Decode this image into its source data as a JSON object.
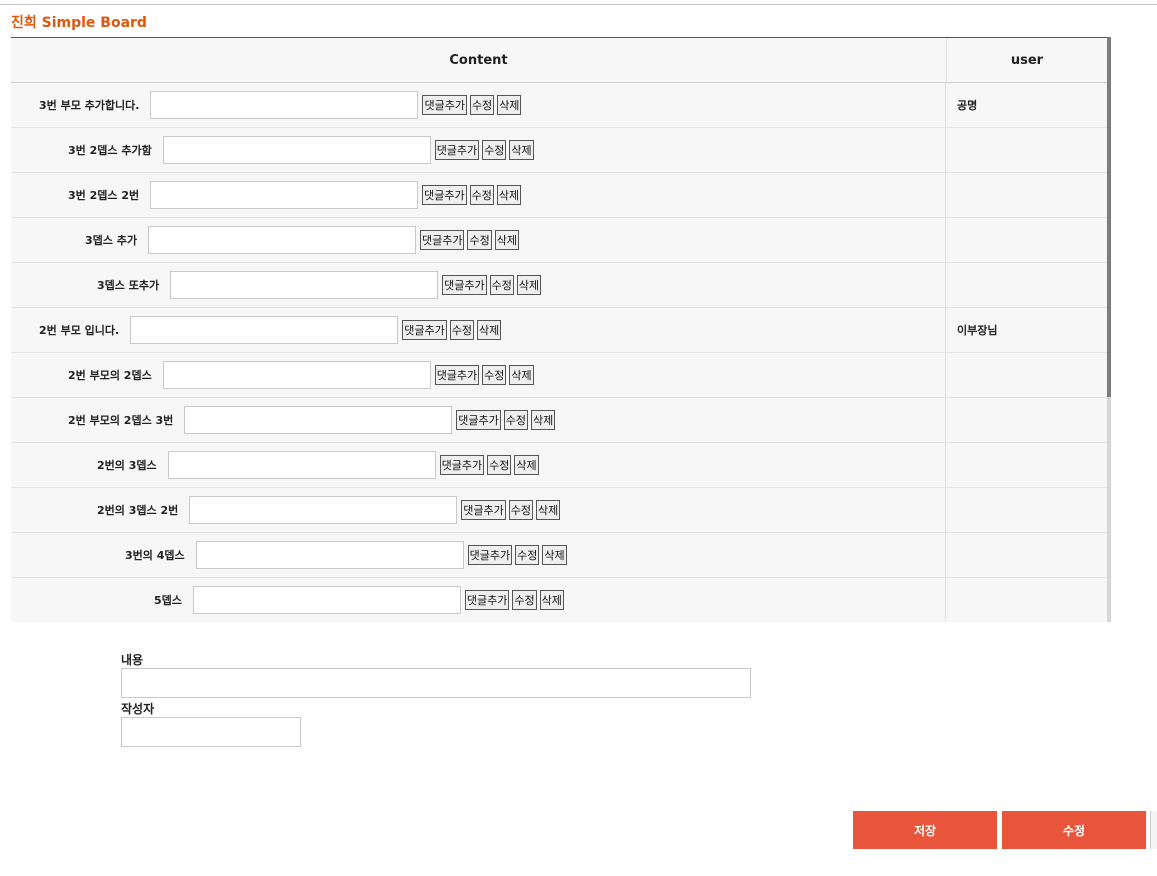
{
  "app": {
    "title": "진희 Simple Board"
  },
  "board": {
    "columns": {
      "content": "Content",
      "user": "user"
    },
    "buttons": {
      "reply": "댓글추가",
      "edit": "수정",
      "delete": "삭제"
    },
    "rows": [
      {
        "label": "3번 부모 추가합니다.",
        "input": "",
        "user": "공명"
      },
      {
        "label": "3번 2뎁스 추가함",
        "input": "",
        "user": ""
      },
      {
        "label": "3번 2뎁스 2번",
        "input": "",
        "user": ""
      },
      {
        "label": "3뎁스 추가",
        "input": "",
        "user": ""
      },
      {
        "label": "3뎁스 또추가",
        "input": "",
        "user": ""
      },
      {
        "label": "2번 부모 입니다.",
        "input": "",
        "user": "이부장님"
      },
      {
        "label": "2번 부모의 2뎁스",
        "input": "",
        "user": ""
      },
      {
        "label": "2번 부모의 2뎁스 3번",
        "input": "",
        "user": ""
      },
      {
        "label": "2번의 3뎁스",
        "input": "",
        "user": ""
      },
      {
        "label": "2번의 3뎁스 2번",
        "input": "",
        "user": ""
      },
      {
        "label": "3번의 4뎁스",
        "input": "",
        "user": ""
      },
      {
        "label": "5뎁스",
        "input": "",
        "user": ""
      }
    ]
  },
  "form": {
    "content_label": "내용",
    "content_value": "",
    "author_label": "작성자",
    "author_value": "",
    "save_label": "저장",
    "edit_label": "수정"
  },
  "colors": {
    "title": "#e0580c",
    "primary_button": "#e8553a"
  }
}
